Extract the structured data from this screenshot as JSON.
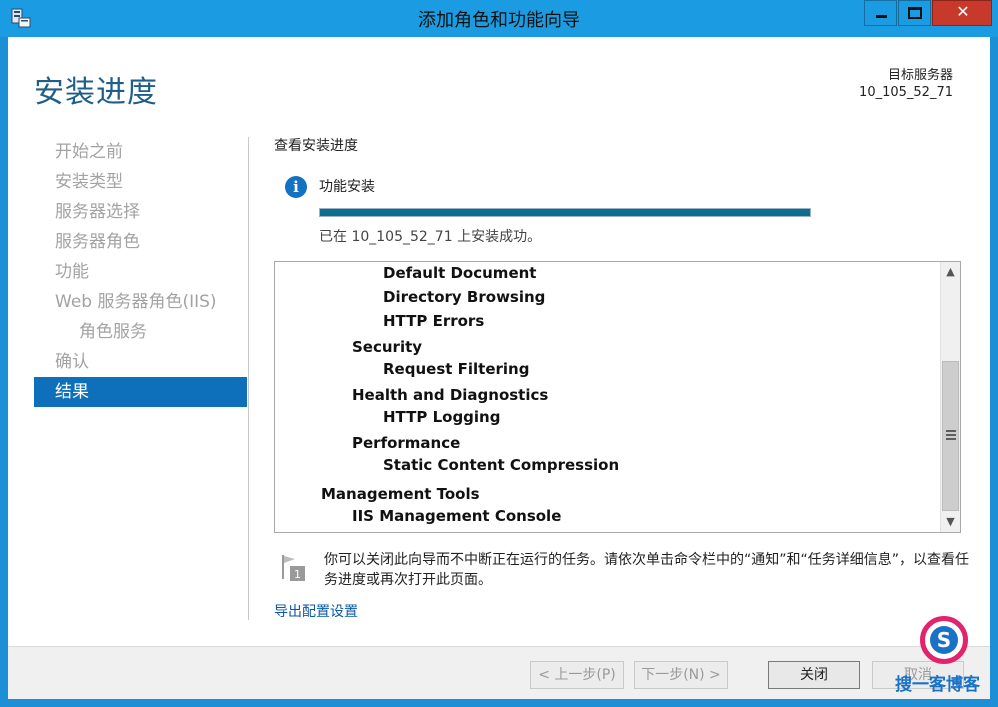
{
  "window": {
    "title": "添加角色和功能向导",
    "min_glyph": "—",
    "max_glyph": "☐",
    "close_glyph": "✕"
  },
  "header": {
    "title": "安装进度",
    "target_label": "目标服务器",
    "target_value": "10_105_52_71"
  },
  "sidebar": {
    "items": [
      {
        "label": "开始之前",
        "state": "disabled"
      },
      {
        "label": "安装类型",
        "state": "disabled"
      },
      {
        "label": "服务器选择",
        "state": "disabled"
      },
      {
        "label": "服务器角色",
        "state": "disabled"
      },
      {
        "label": "功能",
        "state": "disabled"
      },
      {
        "label": "Web 服务器角色(IIS)",
        "state": "disabled"
      },
      {
        "label": "角色服务",
        "state": "disabled"
      },
      {
        "label": "确认",
        "state": "disabled"
      },
      {
        "label": "结果",
        "state": "active"
      }
    ]
  },
  "main": {
    "section_title": "查看安装进度",
    "feature_label": "功能安装",
    "progress_fraction": 1.0,
    "success_text": "已在 10_105_52_71 上安装成功。",
    "tree": [
      {
        "text": "Default Document",
        "level": 3
      },
      {
        "text": "Directory Browsing",
        "level": 3
      },
      {
        "text": "HTTP Errors",
        "level": 3
      },
      {
        "text": "Security",
        "level": 2
      },
      {
        "text": "Request Filtering",
        "level": 3
      },
      {
        "text": "Health and Diagnostics",
        "level": 2
      },
      {
        "text": "HTTP Logging",
        "level": 3
      },
      {
        "text": "Performance",
        "level": 2
      },
      {
        "text": "Static Content Compression",
        "level": 3
      },
      {
        "text": "Management Tools",
        "level": 1
      },
      {
        "text": "IIS Management Console",
        "level": 2
      }
    ],
    "notice_badge": "1",
    "notice_text": "你可以关闭此向导而不中断正在运行的任务。请依次单击命令栏中的“通知”和“任务详细信息”，以查看任务进度或再次打开此页面。",
    "export_link": "导出配置设置"
  },
  "footer": {
    "prev_label": "< 上一步(P)",
    "next_label": "下一步(N) >",
    "close_label": "关闭",
    "cancel_label": "取消"
  },
  "watermark": {
    "letter": "S",
    "text": "搜一客博客"
  },
  "colors": {
    "accent": "#1b9ce2",
    "active_nav": "#0e6fba",
    "progress": "#0d6f8f",
    "link": "#0b58a8"
  }
}
